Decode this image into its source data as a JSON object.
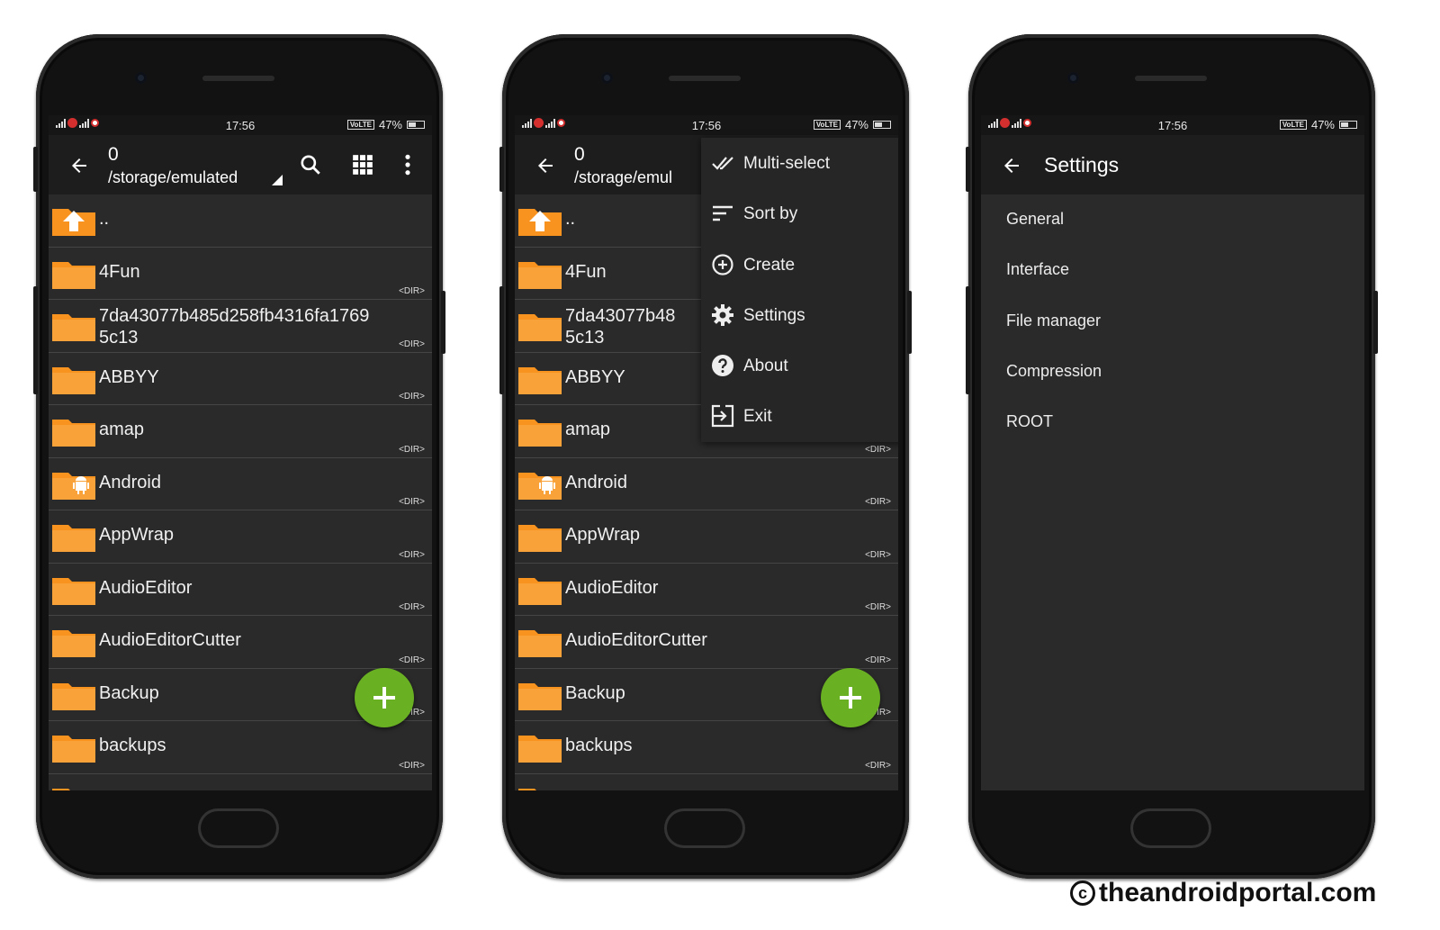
{
  "status_bar": {
    "time": "17:56",
    "battery": "47%",
    "volte": "VoLTE"
  },
  "file_browser": {
    "count": "0",
    "path_full": "/storage/emulated",
    "path_truncated": "/storage/emul",
    "parent_label": "..",
    "dir_tag": "<DIR>",
    "items": [
      {
        "name": "4Fun",
        "icon": "folder-icon"
      },
      {
        "name": "7da43077b485d258fb4316fa1769",
        "name2": "5c13",
        "truncated": "7da43077b48",
        "icon": "folder-icon"
      },
      {
        "name": "ABBYY",
        "icon": "folder-icon"
      },
      {
        "name": "amap",
        "icon": "folder-icon"
      },
      {
        "name": "Android",
        "icon": "android-folder-icon"
      },
      {
        "name": "AppWrap",
        "icon": "folder-icon"
      },
      {
        "name": "AudioEditor",
        "icon": "folder-icon"
      },
      {
        "name": "AudioEditorCutter",
        "icon": "folder-icon"
      },
      {
        "name": "Backup",
        "icon": "folder-icon"
      },
      {
        "name": "backups",
        "icon": "folder-icon"
      }
    ]
  },
  "overflow_menu": {
    "items": [
      {
        "label": "Multi-select",
        "icon": "double-check-icon"
      },
      {
        "label": "Sort by",
        "icon": "sort-icon"
      },
      {
        "label": "Create",
        "icon": "add-circle-icon"
      },
      {
        "label": "Settings",
        "icon": "gear-icon"
      },
      {
        "label": "About",
        "icon": "help-icon"
      },
      {
        "label": "Exit",
        "icon": "exit-icon"
      }
    ]
  },
  "settings": {
    "title": "Settings",
    "items": [
      "General",
      "Interface",
      "File manager",
      "Compression",
      "ROOT"
    ]
  },
  "watermark": "theandroidportal.com",
  "colors": {
    "folder": "#f7931e",
    "fab": "#6ab023",
    "background": "#2a2a2a",
    "toolbar": "#1d1d1d"
  }
}
